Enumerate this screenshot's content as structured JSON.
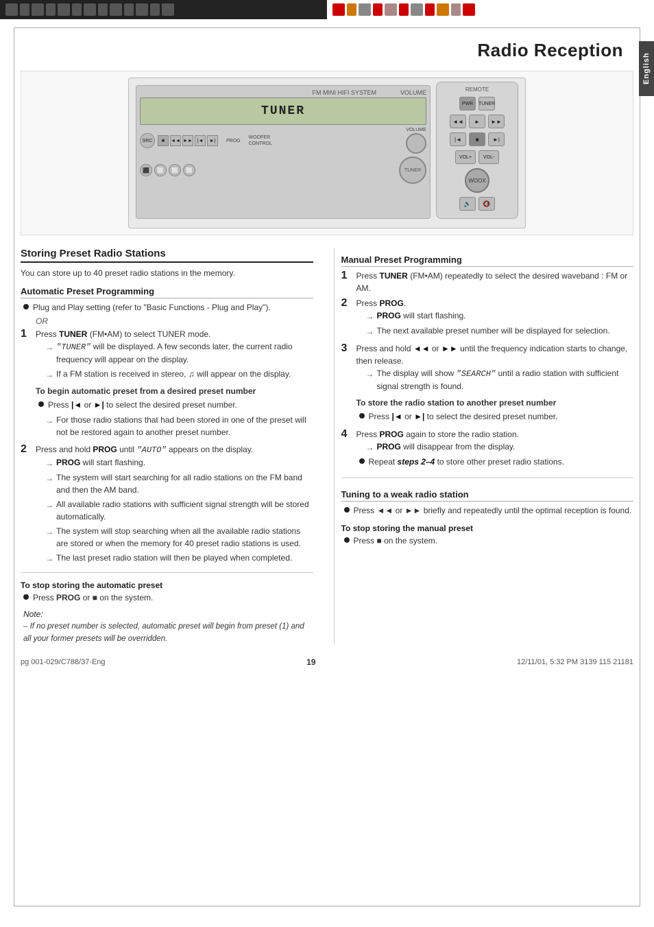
{
  "page": {
    "title": "Radio Reception",
    "page_number": "19",
    "language_tab": "English",
    "footer_left": "pg 001-029/C788/37-Eng",
    "footer_center": "19",
    "footer_right": "12/11/01, 5:32 PM 3139 115 21181"
  },
  "left_section": {
    "title": "Storing Preset Radio Stations",
    "intro": "You can store up to 40 preset radio stations in the memory.",
    "auto_section": {
      "title": "Automatic Preset Programming",
      "bullets": [
        "Plug and Play setting (refer to \"Basic Functions - Plug and Play\").",
        "OR"
      ],
      "steps": [
        {
          "num": "1",
          "text": "Press TUNER (FM•AM) to select TUNER mode.",
          "arrows": [
            "\"TUNER\" will be displayed. A few seconds later, the current radio frequency will appear on the display.",
            "If a FM station is received in stereo, ♫ will appear on the display."
          ],
          "action_label": "To begin automatic preset from a desired preset number",
          "sub_bullets": [
            "Press |◄ or ►| to select the desired preset number.",
            "For those radio stations that had been stored in one of the preset will not be restored again to another preset number."
          ]
        },
        {
          "num": "2",
          "text": "Press and hold PROG until \"AUTO\" appears on the display.",
          "arrows": [
            "PROG will start flashing.",
            "The system will start searching for all radio stations on the FM band and then the AM band.",
            "All available radio stations with sufficient signal strength will be stored automatically.",
            "The system will stop searching when all the available radio stations are stored or when the memory for 40 preset radio stations is used.",
            "The last preset radio station will then be played when completed."
          ]
        }
      ]
    },
    "stop_auto_label": "To stop storing the automatic preset",
    "stop_auto_text": "Press PROG or ■ on the system.",
    "note_label": "Note:",
    "note_text": "– If no preset number is selected, automatic preset will begin from preset (1) and all your former presets will be overridden."
  },
  "right_section": {
    "manual_section": {
      "title": "Manual Preset Programming",
      "steps": [
        {
          "num": "1",
          "text": "Press TUNER (FM•AM) repeatedly to select the desired waveband : FM or AM."
        },
        {
          "num": "2",
          "text": "Press PROG.",
          "arrows": [
            "PROG will start flashing.",
            "The next available preset number will be displayed for selection."
          ]
        },
        {
          "num": "3",
          "text": "Press and hold ◄◄ or ►► until the frequency indication starts to change, then release.",
          "arrows": [
            "The display will show \"SEARCH\" until a radio station with sufficient signal strength is found."
          ],
          "action_label": "To store the radio station to another preset number",
          "sub_bullets": [
            "Press |◄ or ►| to select the desired preset number."
          ]
        },
        {
          "num": "4",
          "text": "Press PROG again to store the radio station.",
          "arrows": [
            "PROG will disappear from the display."
          ],
          "sub_bullets": [
            "Repeat steps 2–4 to store other preset radio stations."
          ]
        }
      ]
    },
    "weak_section": {
      "title": "Tuning to a weak radio station",
      "bullets": [
        "Press ◄◄ or ►► briefly and repeatedly until the optimal reception is found."
      ]
    },
    "stop_manual_label": "To stop storing the manual preset",
    "stop_manual_text": "Press ■ on the system."
  }
}
